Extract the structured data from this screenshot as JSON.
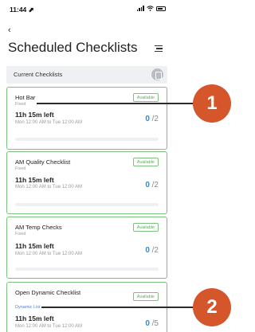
{
  "status_bar": {
    "time": "11:44 ⬈"
  },
  "header": {
    "back": "‹",
    "title": "Scheduled Checklists"
  },
  "section": {
    "label": "Current Checklists"
  },
  "checklists": [
    {
      "name": "Hot Bar",
      "type": "Fixed",
      "badge": "Available",
      "due": "11h 15m left",
      "range": "Mon 12:00 AM to Tue 12:00 AM",
      "done": "0",
      "total": "/2"
    },
    {
      "name": "AM Quality Checklist",
      "type": "Fixed",
      "badge": "Available",
      "due": "11h 15m left",
      "range": "Mon 12:00 AM to Tue 12:00 AM",
      "done": "0",
      "total": "/2"
    },
    {
      "name": "AM Temp Checks",
      "type": "Fixed",
      "badge": "Available",
      "due": "11h 15m left",
      "range": "Mon 12:00 AM to Tue 12:00 AM",
      "done": "0",
      "total": "/2"
    },
    {
      "name": "Open Dynamic Checklist",
      "type": "Dynamic List",
      "badge": "Available",
      "due": "11h 15m left",
      "range": "Mon 12:00 AM to Tue 12:00 AM",
      "done": "0",
      "total": "/5"
    }
  ],
  "callouts": [
    "1",
    "2"
  ],
  "colors": {
    "accent_orange": "#d4562a",
    "card_border_green": "#7cc27f",
    "count_blue": "#3a86c8"
  }
}
